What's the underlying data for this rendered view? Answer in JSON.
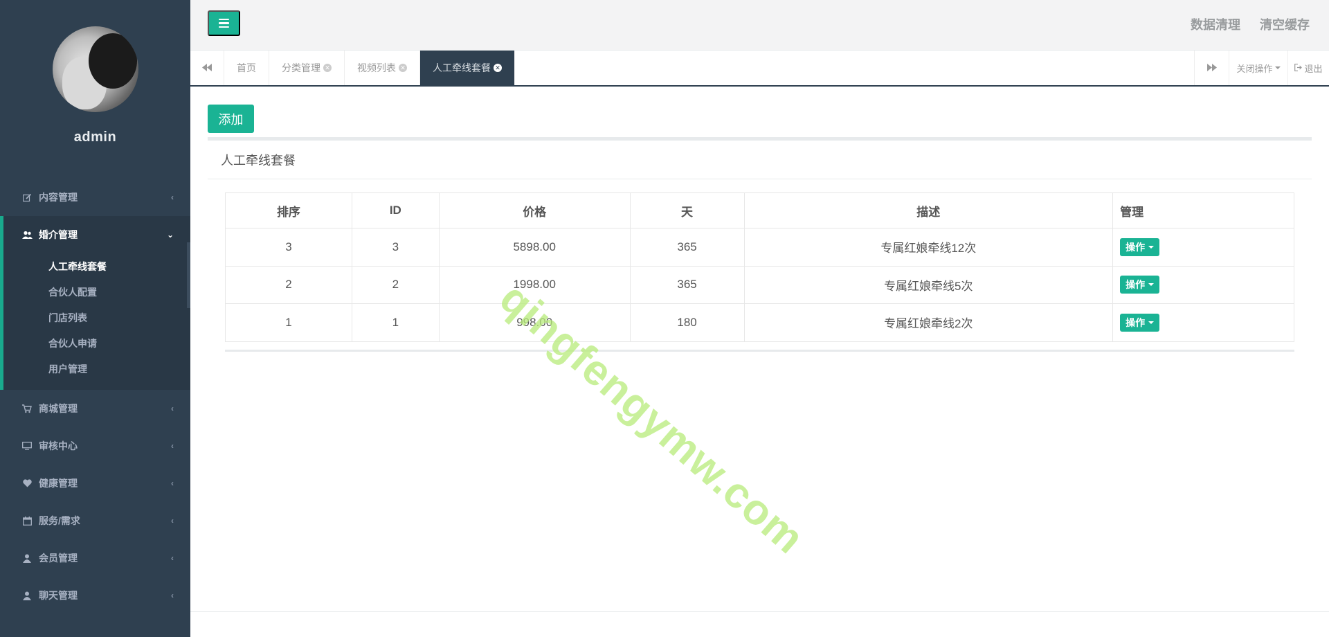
{
  "sidebar": {
    "username": "admin",
    "menu": [
      {
        "label": "内容管理",
        "icon": "edit-icon"
      },
      {
        "label": "婚介管理",
        "icon": "users-icon",
        "active": true,
        "submenu": [
          "人工牵线套餐",
          "合伙人配置",
          "门店列表",
          "合伙人申请",
          "用户管理"
        ]
      },
      {
        "label": "商城管理",
        "icon": "cart-icon"
      },
      {
        "label": "审核中心",
        "icon": "monitor-icon"
      },
      {
        "label": "健康管理",
        "icon": "heart-icon"
      },
      {
        "label": "服务/需求",
        "icon": "calendar-icon"
      },
      {
        "label": "会员管理",
        "icon": "user-icon"
      },
      {
        "label": "聊天管理",
        "icon": "user-icon"
      }
    ]
  },
  "topbar": {
    "links": [
      "数据清理",
      "清空缓存"
    ]
  },
  "tabs": {
    "items": [
      {
        "label": "首页",
        "closable": false
      },
      {
        "label": "分类管理",
        "closable": true
      },
      {
        "label": "视频列表",
        "closable": true
      },
      {
        "label": "人工牵线套餐",
        "closable": true,
        "active": true
      }
    ],
    "close_ops": "关闭操作",
    "logout": "退出"
  },
  "content": {
    "add_button": "添加",
    "panel_title": "人工牵线套餐",
    "table": {
      "headers": [
        "排序",
        "ID",
        "价格",
        "天",
        "描述",
        "管理"
      ],
      "rows": [
        {
          "sort": "3",
          "id": "3",
          "price": "5898.00",
          "days": "365",
          "desc": "专属红娘牵线12次",
          "action": "操作"
        },
        {
          "sort": "2",
          "id": "2",
          "price": "1998.00",
          "days": "365",
          "desc": "专属红娘牵线5次",
          "action": "操作"
        },
        {
          "sort": "1",
          "id": "1",
          "price": "998.00",
          "days": "180",
          "desc": "专属红娘牵线2次",
          "action": "操作"
        }
      ]
    }
  },
  "watermark": "qingfengymw.com",
  "colors": {
    "sidebar_bg": "#2f4050",
    "accent": "#1ab394",
    "watermark": "#b8ec7a"
  }
}
